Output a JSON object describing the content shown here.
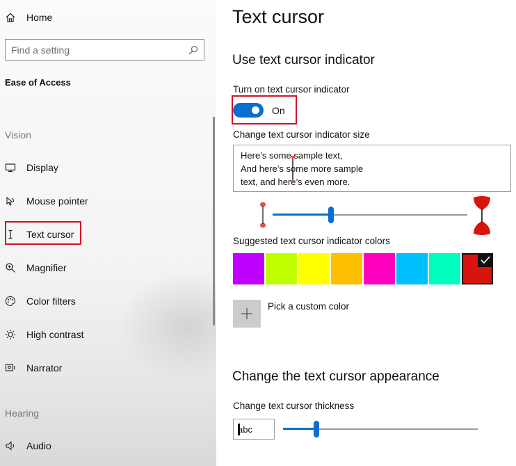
{
  "sidebar": {
    "home_label": "Home",
    "search_placeholder": "Find a setting",
    "section_title": "Ease of Access",
    "vision_label": "Vision",
    "hearing_label": "Hearing",
    "items": [
      {
        "label": "Display",
        "icon": "display-icon"
      },
      {
        "label": "Mouse pointer",
        "icon": "mouse-pointer-icon"
      },
      {
        "label": "Text cursor",
        "icon": "text-cursor-icon",
        "selected": true
      },
      {
        "label": "Magnifier",
        "icon": "magnifier-icon"
      },
      {
        "label": "Color filters",
        "icon": "color-filters-icon"
      },
      {
        "label": "High contrast",
        "icon": "high-contrast-icon"
      },
      {
        "label": "Narrator",
        "icon": "narrator-icon"
      }
    ],
    "hearing_items": [
      {
        "label": "Audio",
        "icon": "audio-icon"
      }
    ]
  },
  "main": {
    "title": "Text cursor",
    "indicator_heading": "Use text cursor indicator",
    "toggle_label": "Turn on text cursor indicator",
    "toggle_state": "On",
    "size_label": "Change text cursor indicator size",
    "sample_lines": [
      "Here’s some sample text,",
      "And here’s some more sample",
      "text, and here’s even more."
    ],
    "indicator_size_value": 0.3,
    "colors_label": "Suggested text cursor indicator colors",
    "colors": [
      "#bf00ff",
      "#c0ff00",
      "#ffff00",
      "#ffbf00",
      "#ff00bf",
      "#00bfff",
      "#00ffbf",
      "#d9140f"
    ],
    "selected_color_index": 7,
    "custom_color_label": "Pick a custom color",
    "appearance_heading": "Change the text cursor appearance",
    "thickness_label": "Change text cursor thickness",
    "thickness_preview": "abc",
    "thickness_value": 0.17,
    "accent_color": "#0a6ecf",
    "highlight_color": "#d01426"
  }
}
